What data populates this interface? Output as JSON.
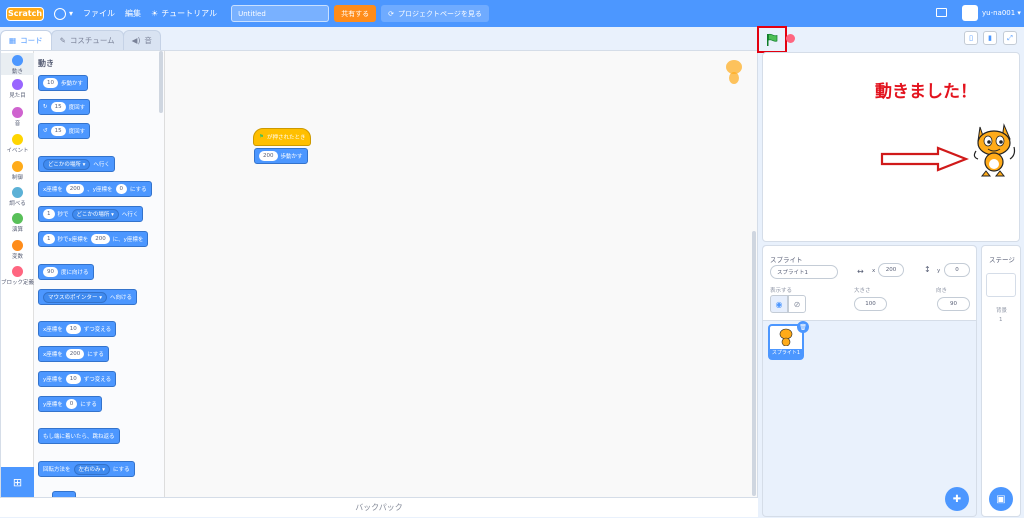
{
  "menubar": {
    "logo": "Scratch",
    "file": "ファイル",
    "edit": "編集",
    "tutorials": "チュートリアル",
    "project_title": "Untitled",
    "share": "共有する",
    "see_project": "プロジェクトページを見る",
    "username": "yu-na001"
  },
  "tabs": {
    "code": "コード",
    "costumes": "コスチューム",
    "sounds": "音"
  },
  "categories": [
    {
      "label": "動き",
      "color": "#4c97ff"
    },
    {
      "label": "見た目",
      "color": "#9966ff"
    },
    {
      "label": "音",
      "color": "#cf63cf"
    },
    {
      "label": "イベント",
      "color": "#ffd500"
    },
    {
      "label": "制御",
      "color": "#ffab19"
    },
    {
      "label": "調べる",
      "color": "#5cb1d6"
    },
    {
      "label": "演算",
      "color": "#59c059"
    },
    {
      "label": "変数",
      "color": "#ff8c1a"
    },
    {
      "label": "ブロック定義",
      "color": "#ff6680"
    }
  ],
  "palette": {
    "heading": "動き",
    "blocks": {
      "move": {
        "val": "10",
        "suffix": "歩動かす"
      },
      "turn_right": {
        "val": "15",
        "suffix": "度回す"
      },
      "turn_left": {
        "val": "15",
        "suffix": "度回す"
      },
      "goto": {
        "dd": "どこかの場所",
        "suffix": "へ行く"
      },
      "gotoxy": {
        "p1": "x座標を",
        "x": "200",
        "p2": "、y座標を",
        "y": "0",
        "p3": "にする"
      },
      "glide_to": {
        "val": "1",
        "p1": "秒で",
        "dd": "どこかの場所",
        "p2": "へ行く"
      },
      "glide_xy": {
        "val": "1",
        "p1": "秒でx座標を",
        "x": "200",
        "p2": "に、y座標を"
      },
      "point_dir": {
        "val": "90",
        "suffix": "度に向ける"
      },
      "point_towards": {
        "dd": "マウスのポインター",
        "suffix": "へ向ける"
      },
      "change_x": {
        "prefix": "x座標を",
        "val": "10",
        "suffix": "ずつ変える"
      },
      "set_x": {
        "prefix": "x座標を",
        "val": "200",
        "suffix": "にする"
      },
      "change_y": {
        "prefix": "y座標を",
        "val": "10",
        "suffix": "ずつ変える"
      },
      "set_y": {
        "prefix": "y座標を",
        "val": "0",
        "suffix": "にする"
      },
      "bounce": {
        "text": "もし端に着いたら、跳ね返る"
      },
      "rotation": {
        "prefix": "回転方法を",
        "dd": "左右のみ",
        "suffix": "にする"
      }
    }
  },
  "workspace": {
    "hat": "が押されたとき",
    "move_val": "200",
    "move_suffix": "歩動かす"
  },
  "backpack": "バックパック",
  "stage": {
    "caption": "動きました！"
  },
  "sprite_info": {
    "sprite_label": "スプライト",
    "sprite_name": "スプライト1",
    "x_label": "x",
    "x": "200",
    "y_label": "y",
    "y": "0",
    "show_label": "表示する",
    "size_label": "大きさ",
    "size": "100",
    "direction_label": "向き",
    "direction": "90",
    "thumb_label": "スプライト1"
  },
  "stage_panel": {
    "title": "ステージ",
    "backdrops_label": "背景",
    "backdrops_count": "1"
  }
}
